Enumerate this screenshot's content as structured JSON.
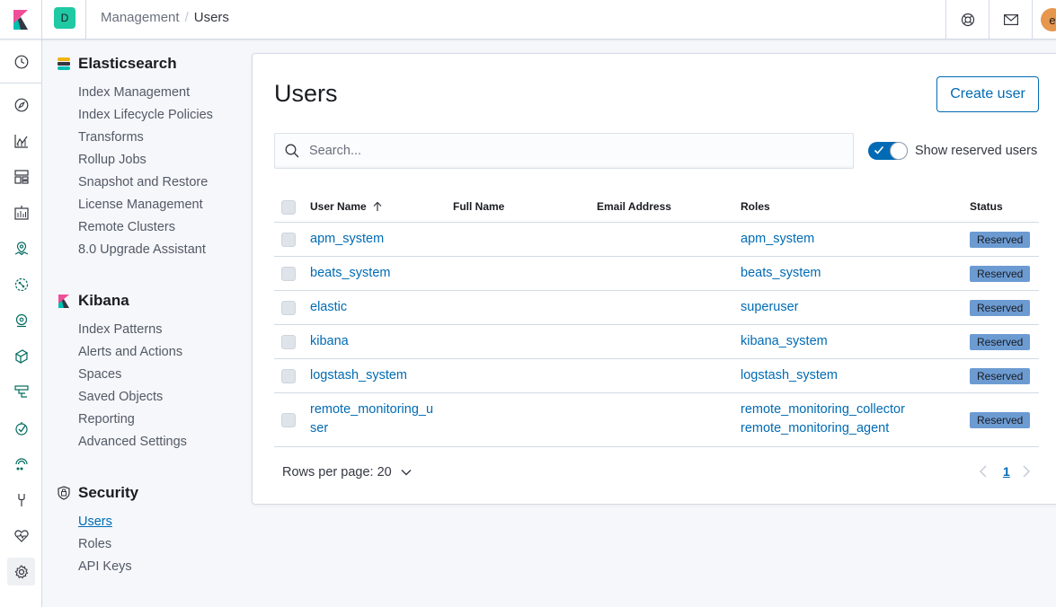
{
  "header": {
    "space_initial": "D",
    "breadcrumbs": [
      "Management",
      "Users"
    ],
    "avatar_initial": "e"
  },
  "rail": {
    "icons": [
      "clock-icon",
      "compass-icon",
      "visualize-icon",
      "dashboard-icon",
      "canvas-icon",
      "maps-icon",
      "ml-icon",
      "graph-icon",
      "observability-icon",
      "logs-icon",
      "apm-icon",
      "uptime-icon",
      "dev-tools-icon",
      "stack-monitoring-icon",
      "gear-icon"
    ]
  },
  "sidenav": {
    "groups": [
      {
        "title": "Elasticsearch",
        "items": [
          "Index Management",
          "Index Lifecycle Policies",
          "Transforms",
          "Rollup Jobs",
          "Snapshot and Restore",
          "License Management",
          "Remote Clusters",
          "8.0 Upgrade Assistant"
        ]
      },
      {
        "title": "Kibana",
        "items": [
          "Index Patterns",
          "Alerts and Actions",
          "Spaces",
          "Saved Objects",
          "Reporting",
          "Advanced Settings"
        ]
      },
      {
        "title": "Security",
        "items": [
          "Users",
          "Roles",
          "API Keys"
        ]
      }
    ]
  },
  "main": {
    "title": "Users",
    "create_button": "Create user",
    "search_placeholder": "Search...",
    "toggle_label": "Show reserved users",
    "toggle_on": true,
    "columns": [
      "User Name",
      "Full Name",
      "Email Address",
      "Roles",
      "Status"
    ],
    "rows": [
      {
        "username": "apm_system",
        "username_lines": [
          "apm_system"
        ],
        "full_name": "",
        "email": "",
        "roles": [
          "apm_system"
        ],
        "status": "Reserved"
      },
      {
        "username": "beats_system",
        "username_lines": [
          "beats_system"
        ],
        "full_name": "",
        "email": "",
        "roles": [
          "beats_system"
        ],
        "status": "Reserved"
      },
      {
        "username": "elastic",
        "username_lines": [
          "elastic"
        ],
        "full_name": "",
        "email": "",
        "roles": [
          "superuser"
        ],
        "status": "Reserved"
      },
      {
        "username": "kibana",
        "username_lines": [
          "kibana"
        ],
        "full_name": "",
        "email": "",
        "roles": [
          "kibana_system"
        ],
        "status": "Reserved"
      },
      {
        "username": "logstash_system",
        "username_lines": [
          "logstash_system"
        ],
        "full_name": "",
        "email": "",
        "roles": [
          "logstash_system"
        ],
        "status": "Reserved"
      },
      {
        "username": "remote_monitoring_user",
        "username_lines": [
          "remote_monitoring_u",
          "ser"
        ],
        "full_name": "",
        "email": "",
        "roles": [
          "remote_monitoring_collector",
          "remote_monitoring_agent"
        ],
        "status": "Reserved"
      }
    ],
    "rows_per_page_label": "Rows per page: 20",
    "current_page": "1"
  },
  "colors": {
    "accent": "#006bb4",
    "badge": "#6c9bd2",
    "space": "#1ec9a3",
    "avatar": "#e7964d"
  }
}
